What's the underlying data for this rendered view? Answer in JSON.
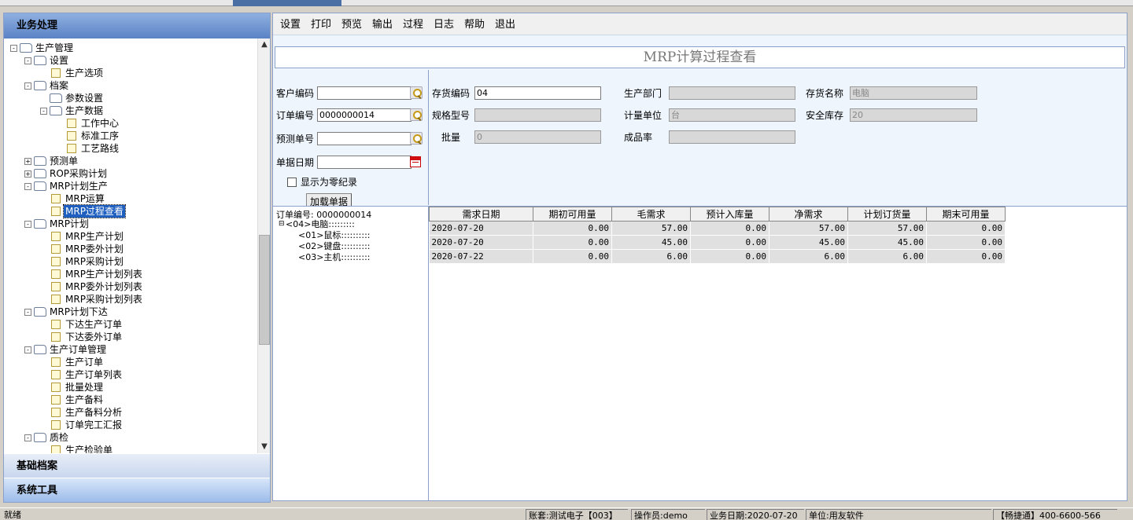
{
  "left_panel": {
    "header": "业务处理",
    "sections": [
      "基础档案",
      "系统工具"
    ],
    "tree": [
      {
        "label": "生产管理",
        "level": 0,
        "type": "folder",
        "exp": "-"
      },
      {
        "label": "设置",
        "level": 1,
        "type": "folder",
        "exp": "-"
      },
      {
        "label": "生产选项",
        "level": 2,
        "type": "doc"
      },
      {
        "label": "档案",
        "level": 1,
        "type": "folder",
        "exp": "-"
      },
      {
        "label": "参数设置",
        "level": 2,
        "type": "folder"
      },
      {
        "label": "生产数据",
        "level": 2,
        "type": "folder",
        "exp": "-"
      },
      {
        "label": "工作中心",
        "level": 3,
        "type": "doc"
      },
      {
        "label": "标准工序",
        "level": 3,
        "type": "doc"
      },
      {
        "label": "工艺路线",
        "level": 3,
        "type": "doc"
      },
      {
        "label": "预测单",
        "level": 1,
        "type": "folder",
        "exp": "+"
      },
      {
        "label": "ROP采购计划",
        "level": 1,
        "type": "folder",
        "exp": "+"
      },
      {
        "label": "MRP计划生产",
        "level": 1,
        "type": "folder",
        "exp": "-"
      },
      {
        "label": "MRP运算",
        "level": 2,
        "type": "doc"
      },
      {
        "label": "MRP过程查看",
        "level": 2,
        "type": "doc",
        "selected": true
      },
      {
        "label": "MRP计划",
        "level": 1,
        "type": "folder",
        "exp": "-"
      },
      {
        "label": "MRP生产计划",
        "level": 2,
        "type": "doc"
      },
      {
        "label": "MRP委外计划",
        "level": 2,
        "type": "doc"
      },
      {
        "label": "MRP采购计划",
        "level": 2,
        "type": "doc"
      },
      {
        "label": "MRP生产计划列表",
        "level": 2,
        "type": "doc"
      },
      {
        "label": "MRP委外计划列表",
        "level": 2,
        "type": "doc"
      },
      {
        "label": "MRP采购计划列表",
        "level": 2,
        "type": "doc"
      },
      {
        "label": "MRP计划下达",
        "level": 1,
        "type": "folder",
        "exp": "-"
      },
      {
        "label": "下达生产订单",
        "level": 2,
        "type": "doc"
      },
      {
        "label": "下达委外订单",
        "level": 2,
        "type": "doc"
      },
      {
        "label": "生产订单管理",
        "level": 1,
        "type": "folder",
        "exp": "-"
      },
      {
        "label": "生产订单",
        "level": 2,
        "type": "doc"
      },
      {
        "label": "生产订单列表",
        "level": 2,
        "type": "doc"
      },
      {
        "label": "批量处理",
        "level": 2,
        "type": "doc"
      },
      {
        "label": "生产备料",
        "level": 2,
        "type": "doc"
      },
      {
        "label": "生产备料分析",
        "level": 2,
        "type": "doc"
      },
      {
        "label": "订单完工汇报",
        "level": 2,
        "type": "doc"
      },
      {
        "label": "质检",
        "level": 1,
        "type": "folder",
        "exp": "-"
      },
      {
        "label": "生产检验单",
        "level": 2,
        "type": "doc"
      }
    ]
  },
  "toolbar": [
    "设置",
    "打印",
    "预览",
    "输出",
    "过程",
    "日志",
    "帮助",
    "退出"
  ],
  "title": "MRP计算过程查看",
  "form_left": {
    "customer_code_label": "客户编码",
    "customer_code": "",
    "order_no_label": "订单编号",
    "order_no": "0000000014",
    "forecast_no_label": "预测单号",
    "forecast_no": "",
    "doc_date_label": "单据日期",
    "doc_date": "",
    "show_zero_label": "显示为零纪录",
    "load_button": "加载单据"
  },
  "form_right": {
    "inv_code_label": "存货编码",
    "inv_code": "04",
    "prod_dept_label": "生产部门",
    "prod_dept": "",
    "inv_name_label": "存货名称",
    "inv_name": "电脑",
    "spec_label": "规格型号",
    "spec": "",
    "unit_label": "计量单位",
    "unit": "台",
    "safety_stock_label": "安全库存",
    "safety_stock": "20",
    "batch_label": "批量",
    "batch": "0",
    "yield_label": "成品率",
    "yield": ""
  },
  "bom": {
    "title": "订单编号: 0000000014",
    "lines": [
      "<04>电脑:::::::::",
      "<01>鼠标::::::::::",
      "<02>键盘::::::::::",
      "<03>主机::::::::::"
    ]
  },
  "grid": {
    "columns": [
      "需求日期",
      "期初可用量",
      "毛需求",
      "预计入库量",
      "净需求",
      "计划订货量",
      "期末可用量"
    ],
    "rows": [
      [
        "2020-07-20",
        "0.00",
        "57.00",
        "0.00",
        "57.00",
        "57.00",
        "0.00"
      ],
      [
        "2020-07-20",
        "0.00",
        "45.00",
        "0.00",
        "45.00",
        "45.00",
        "0.00"
      ],
      [
        "2020-07-22",
        "0.00",
        "6.00",
        "0.00",
        "6.00",
        "6.00",
        "0.00"
      ]
    ]
  },
  "status": {
    "ready": "就绪",
    "account": "账套:测试电子【003】",
    "operator": "操作员:demo",
    "biz_date": "业务日期:2020-07-20",
    "company": "单位:用友软件",
    "hotline": "【畅捷通】400-6600-566"
  }
}
